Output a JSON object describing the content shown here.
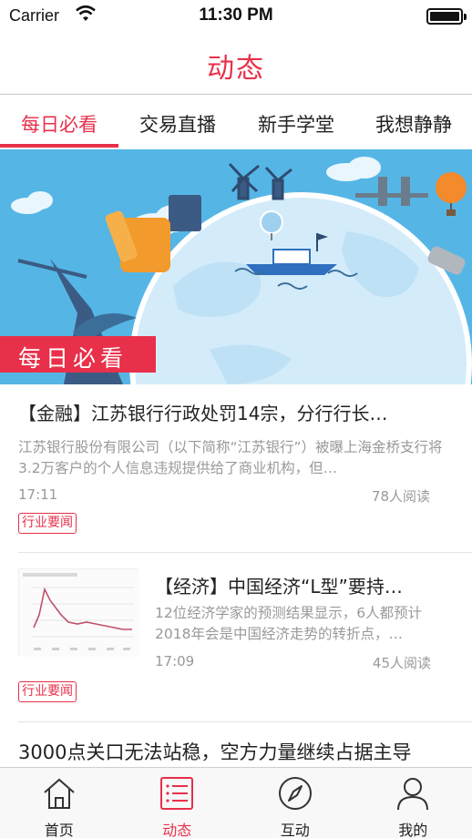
{
  "status_bar": {
    "carrier": "Carrier",
    "time": "11:30 PM"
  },
  "nav": {
    "title": "动态"
  },
  "tabs": [
    {
      "label": "每日必看",
      "active": true
    },
    {
      "label": "交易直播",
      "active": false
    },
    {
      "label": "新手学堂",
      "active": false
    },
    {
      "label": "我想静静",
      "active": false
    }
  ],
  "banner": {
    "label": "每日必看"
  },
  "articles": [
    {
      "title": "【金融】江苏银行行政处罚14宗，分行行长…",
      "summary": "江苏银行股份有限公司（以下简称“江苏银行”）被曝上海金桥支行将3.2万客户的个人信息违规提供给了商业机构，但…",
      "time": "17:11",
      "reads": "78人阅读",
      "tag": "行业要闻"
    },
    {
      "title": "【经济】中国经济“L型”要持…",
      "summary": "12位经济学家的预测结果显示，6人都预计2018年会是中国经济走势的转折点，…",
      "time": "17:09",
      "reads": "45人阅读",
      "tag": "行业要闻"
    },
    {
      "title": "3000点关口无法站稳，空方力量继续占据主导"
    }
  ],
  "tab_bar": [
    {
      "label": "首页",
      "icon": "home-icon",
      "active": false
    },
    {
      "label": "动态",
      "icon": "list-icon",
      "active": true
    },
    {
      "label": "互动",
      "icon": "compass-icon",
      "active": false
    },
    {
      "label": "我的",
      "icon": "user-icon",
      "active": false
    }
  ],
  "colors": {
    "accent": "#e8304a",
    "sky": "#4fb3e4"
  }
}
